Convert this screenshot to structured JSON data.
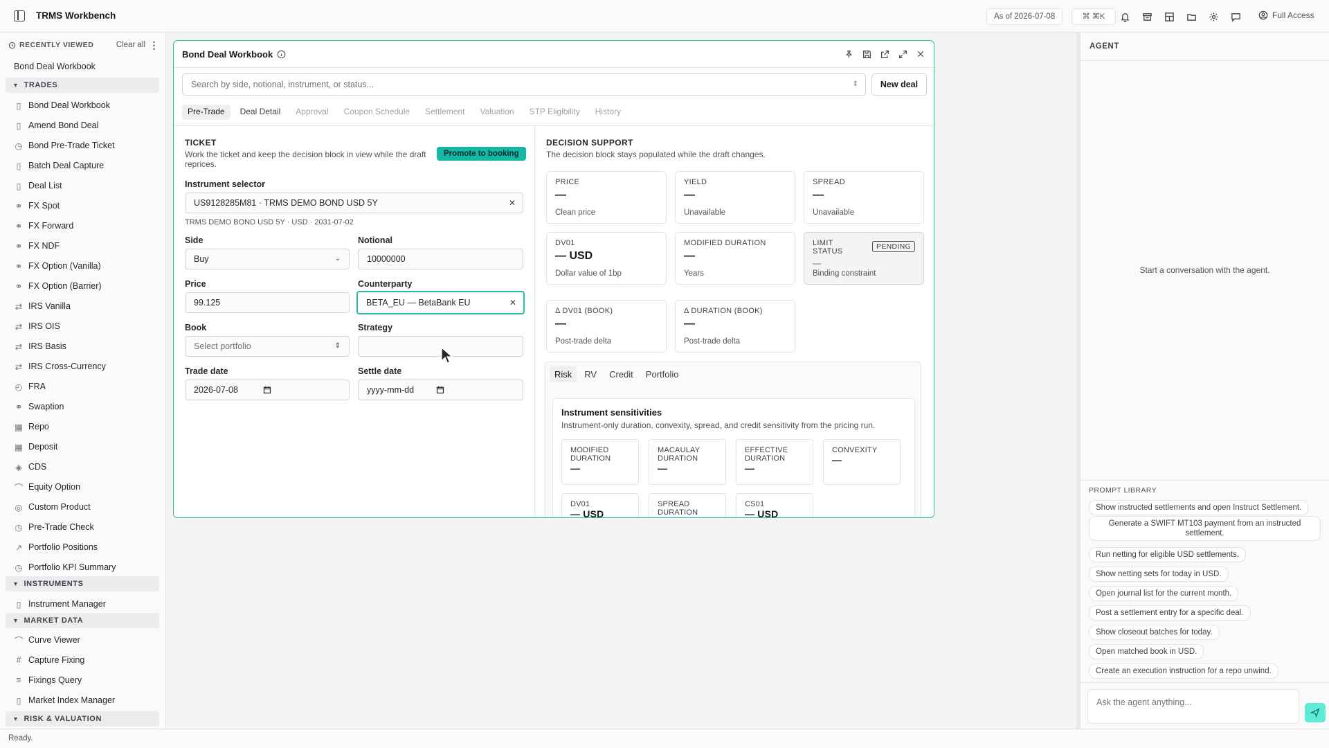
{
  "app": {
    "title": "TRMS Workbench",
    "as_of": "As of 2026-07-08",
    "cmdk": "⌘ ⌘K",
    "full_access": "Full Access",
    "status": "Ready."
  },
  "sidebar": {
    "recent_header": "RECENTLY VIEWED",
    "clear_all": "Clear all",
    "recent_items": [
      "Bond Deal Workbook"
    ],
    "sections": [
      {
        "label": "TRADES"
      },
      {
        "label": "INSTRUMENTS"
      },
      {
        "label": "MARKET DATA"
      },
      {
        "label": "RISK & VALUATION"
      }
    ],
    "trades": [
      "Bond Deal Workbook",
      "Amend Bond Deal",
      "Bond Pre-Trade Ticket",
      "Batch Deal Capture",
      "Deal List",
      "FX Spot",
      "FX Forward",
      "FX NDF",
      "FX Option (Vanilla)",
      "FX Option (Barrier)",
      "IRS Vanilla",
      "IRS OIS",
      "IRS Basis",
      "IRS Cross-Currency",
      "FRA",
      "Swaption",
      "Repo",
      "Deposit",
      "CDS",
      "Equity Option",
      "Custom Product",
      "Pre-Trade Check",
      "Portfolio Positions",
      "Portfolio KPI Summary"
    ],
    "instruments": [
      "Instrument Manager"
    ],
    "market_data": [
      "Curve Viewer",
      "Capture Fixing",
      "Fixings Query",
      "Market Index Manager"
    ]
  },
  "workbook": {
    "title": "Bond Deal Workbook",
    "search_placeholder": "Search by side, notional, instrument, or status...",
    "new_deal": "New deal",
    "tabs": [
      "Pre-Trade",
      "Deal Detail",
      "Approval",
      "Coupon Schedule",
      "Settlement",
      "Valuation",
      "STP Eligibility",
      "History"
    ],
    "ticket": {
      "title": "TICKET",
      "desc": "Work the ticket and keep the decision block in view while the draft reprices.",
      "promote": "Promote to booking",
      "instrument_label": "Instrument selector",
      "instrument_value": "US9128285M81 · TRMS DEMO BOND USD 5Y",
      "instrument_meta": "TRMS DEMO BOND USD 5Y · USD · 2031-07-02",
      "side_label": "Side",
      "side_value": "Buy",
      "notional_label": "Notional",
      "notional_value": "10000000",
      "price_label": "Price",
      "price_value": "99.125",
      "counterparty_label": "Counterparty",
      "counterparty_value": "BETA_EU — BetaBank EU",
      "book_label": "Book",
      "book_value": "Select portfolio",
      "strategy_label": "Strategy",
      "strategy_value": "",
      "trade_date_label": "Trade date",
      "trade_date_value": "2026-07-08",
      "settle_date_label": "Settle date",
      "settle_date_value": "yyyy-mm-dd"
    },
    "decision": {
      "title": "DECISION SUPPORT",
      "desc": "The decision block stays populated while the draft changes.",
      "cards": [
        {
          "title": "PRICE",
          "value": "—",
          "sub": "Clean price"
        },
        {
          "title": "YIELD",
          "value": "—",
          "sub": "Unavailable"
        },
        {
          "title": "SPREAD",
          "value": "—",
          "sub": "Unavailable"
        },
        {
          "title": "DV01",
          "value": "— USD",
          "sub": "Dollar value of 1bp"
        },
        {
          "title": "MODIFIED DURATION",
          "value": "—",
          "sub": "Years"
        },
        {
          "title": "LIMIT STATUS",
          "value": "—",
          "sub": "Binding constraint",
          "badge": "PENDING"
        },
        {
          "title": "Δ DV01 (BOOK)",
          "value": "—",
          "sub": "Post-trade delta"
        },
        {
          "title": "Δ DURATION (BOOK)",
          "value": "—",
          "sub": "Post-trade delta"
        }
      ],
      "subtabs": [
        "Risk",
        "RV",
        "Credit",
        "Portfolio"
      ],
      "sens_title": "Instrument sensitivities",
      "sens_desc": "Instrument-only duration, convexity, spread, and credit sensitivity from the pricing run.",
      "metrics": [
        {
          "label": "MODIFIED DURATION",
          "value": "—"
        },
        {
          "label": "MACAULAY DURATION",
          "value": "—"
        },
        {
          "label": "EFFECTIVE DURATION",
          "value": "—"
        },
        {
          "label": "CONVEXITY",
          "value": "—"
        },
        {
          "label": "DV01",
          "value": "— USD"
        },
        {
          "label": "SPREAD DURATION",
          "value": ""
        },
        {
          "label": "CS01",
          "value": "— USD"
        }
      ]
    }
  },
  "agent": {
    "title": "AGENT",
    "empty": "Start a conversation with the agent.",
    "prompt_library": "PROMPT LIBRARY",
    "prompts": [
      "Show instructed settlements and open Instruct Settlement.",
      "Generate a SWIFT MT103 payment from an instructed settlement.",
      "Run netting for eligible USD settlements.",
      "Show netting sets for today in USD.",
      "Open journal list for the current month.",
      "Post a settlement entry for a specific deal.",
      "Show closeout batches for today.",
      "Open matched book in USD.",
      "Create an execution instruction for a repo unwind."
    ],
    "ask_placeholder": "Ask the agent anything..."
  }
}
